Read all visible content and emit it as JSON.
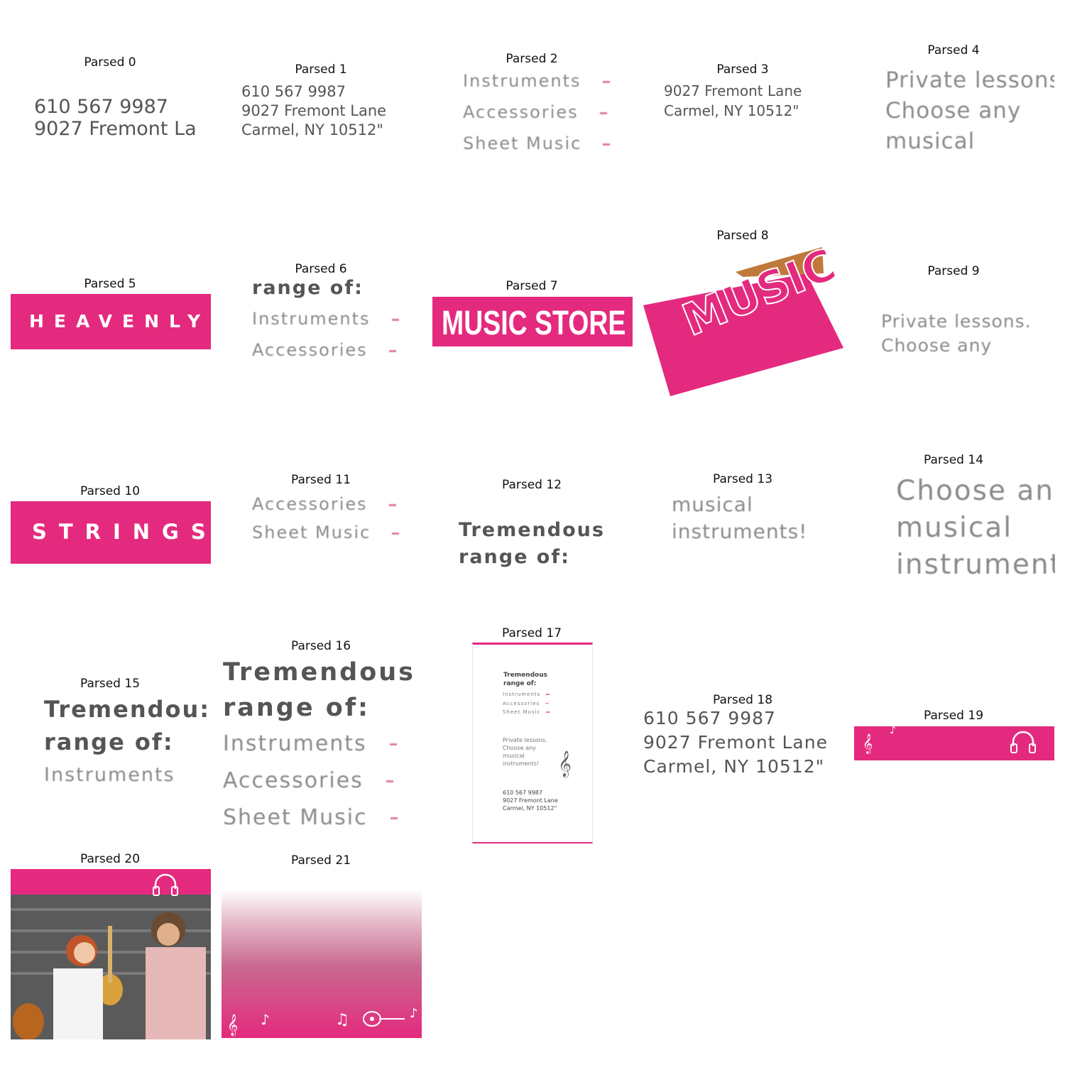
{
  "captions": [
    "Parsed 0",
    "Parsed 1",
    "Parsed 2",
    "Parsed 3",
    "Parsed 4",
    "Parsed 5",
    "Parsed 6",
    "Parsed 7",
    "Parsed 8",
    "Parsed 9",
    "Parsed 10",
    "Parsed 11",
    "Parsed 12",
    "Parsed 13",
    "Parsed 14",
    "Parsed 15",
    "Parsed 16",
    "Parsed 17",
    "Parsed 18",
    "Parsed 19",
    "Parsed 20",
    "Parsed 21"
  ],
  "t0": [
    "610 567 9987",
    "9027 Fremont La"
  ],
  "t1": [
    "610 567 9987",
    "9027 Fremont Lane",
    "Carmel, NY 10512\""
  ],
  "t2": [
    "Instruments",
    "Accessories",
    "Sheet Music"
  ],
  "t3": [
    "9027 Fremont Lane",
    "Carmel, NY 10512\""
  ],
  "t4": [
    "Private lessons",
    "Choose any",
    "musical"
  ],
  "t5": "HEAVENLY",
  "t6": [
    "range of:",
    "Instruments",
    "Accessories"
  ],
  "t7": "MUSIC STORE",
  "t8": "MUSIC",
  "t9": [
    "Private lessons.",
    "Choose any"
  ],
  "t10": "STRINGS",
  "t11": [
    "Accessories",
    "Sheet Music"
  ],
  "t12": [
    "Tremendous",
    "range of:"
  ],
  "t13": [
    "musical",
    "instruments!"
  ],
  "t14": [
    "Choose an",
    "musical",
    "instrument"
  ],
  "t15": [
    "Tremendou:",
    "range of:",
    "Instruments"
  ],
  "t16": [
    "Tremendous",
    "range of:",
    "Instruments",
    "Accessories",
    "Sheet Music"
  ],
  "t17": {
    "heading": [
      "Tremendous",
      "range of:"
    ],
    "items": [
      "Instruments",
      "Accessories",
      "Sheet Music"
    ],
    "lessons": [
      "Private lessons.",
      "Choose any",
      "musical",
      "instruments!"
    ],
    "contact": [
      "610 567 9987",
      "9027 Fremont Lane",
      "Carmel, NY 10512\""
    ]
  },
  "t18": [
    "610 567 9987",
    "9027 Fremont Lane",
    "Carmel, NY 10512\""
  ],
  "colors": {
    "brand_pink": "#e42a7e",
    "text_gray": "#555555"
  },
  "icons": [
    "treble-clef-icon",
    "headphones-icon",
    "guitar-icon",
    "music-note-icon"
  ]
}
